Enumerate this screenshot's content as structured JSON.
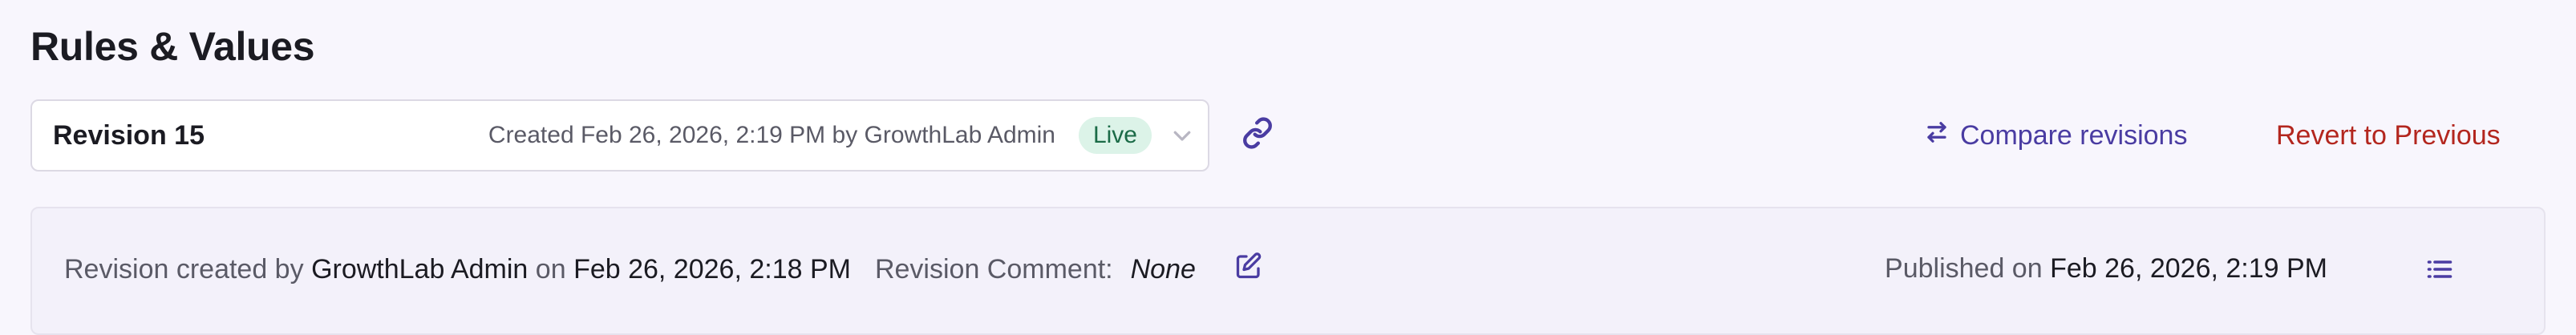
{
  "page": {
    "title": "Rules & Values"
  },
  "revision_select": {
    "name": "Revision 15",
    "meta": "Created Feb 26, 2026, 2:19 PM by GrowthLab Admin",
    "status": "Live",
    "icon": "chevron-down-icon"
  },
  "toolbar": {
    "link_icon": "link-icon",
    "compare_label": "Compare revisions",
    "compare_icon": "swap-arrows-icon",
    "revert_label": "Revert to Previous"
  },
  "revision_info": {
    "created_prefix": "Revision created by",
    "created_by": "GrowthLab Admin",
    "on_label": "on",
    "created_date": "Feb 26, 2026, 2:18 PM",
    "comment_label": "Revision Comment:",
    "comment_value": "None",
    "edit_icon": "edit-icon",
    "published_prefix": "Published on",
    "published_date": "Feb 26, 2026, 2:19 PM",
    "list_icon": "list-icon"
  },
  "colors": {
    "accent": "#4a3ca2",
    "danger": "#b3261e",
    "live_bg": "#dcf3e8",
    "live_text": "#1b6b47"
  }
}
